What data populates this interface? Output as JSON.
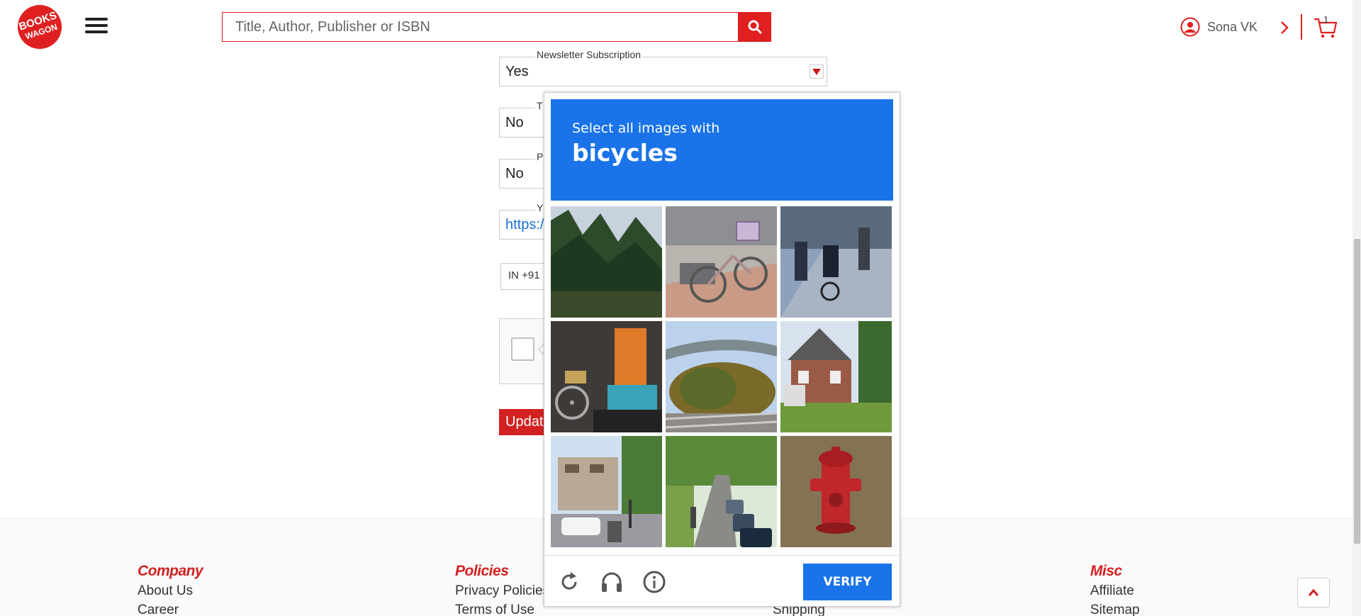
{
  "header": {
    "logo_text": "BOOKS WAGON",
    "search_placeholder": "Title, Author, Publisher or ISBN",
    "user_name": "Sona VK",
    "cart_count": "1",
    "brand_color": "#e02020"
  },
  "form": {
    "newsletter": {
      "label": "Newsletter Subscription",
      "value": "Yes"
    },
    "field2": {
      "label": "T",
      "value": "No"
    },
    "field3": {
      "label": "P",
      "value": "No"
    },
    "field4": {
      "label": "Y",
      "value": "https:/"
    },
    "phone_code": "IN +91",
    "update_button": "Updat"
  },
  "captcha": {
    "prompt": "Select all images with",
    "target": "bicycles",
    "verify_button": "VERIFY",
    "accent_color": "#1a73e8",
    "tiles": [
      "pine-trees",
      "bicycle-with-basket",
      "cyclists-on-sidewalk",
      "bicycle-near-excavator",
      "overpass-with-trees",
      "house-with-porch",
      "street-with-parked-cars",
      "tree-lined-street",
      "fire-hydrant"
    ],
    "icons": [
      "reload-icon",
      "audio-icon",
      "info-icon"
    ]
  },
  "footer": {
    "columns": [
      {
        "heading": "Company",
        "links": [
          "About Us",
          "Career"
        ]
      },
      {
        "heading": "Policies",
        "links": [
          "Privacy Policies",
          "Terms of Use"
        ]
      },
      {
        "heading": "",
        "links": [
          "",
          "Shipping"
        ]
      },
      {
        "heading": "Misc",
        "links": [
          "Affiliate",
          "Sitemap"
        ]
      }
    ]
  }
}
